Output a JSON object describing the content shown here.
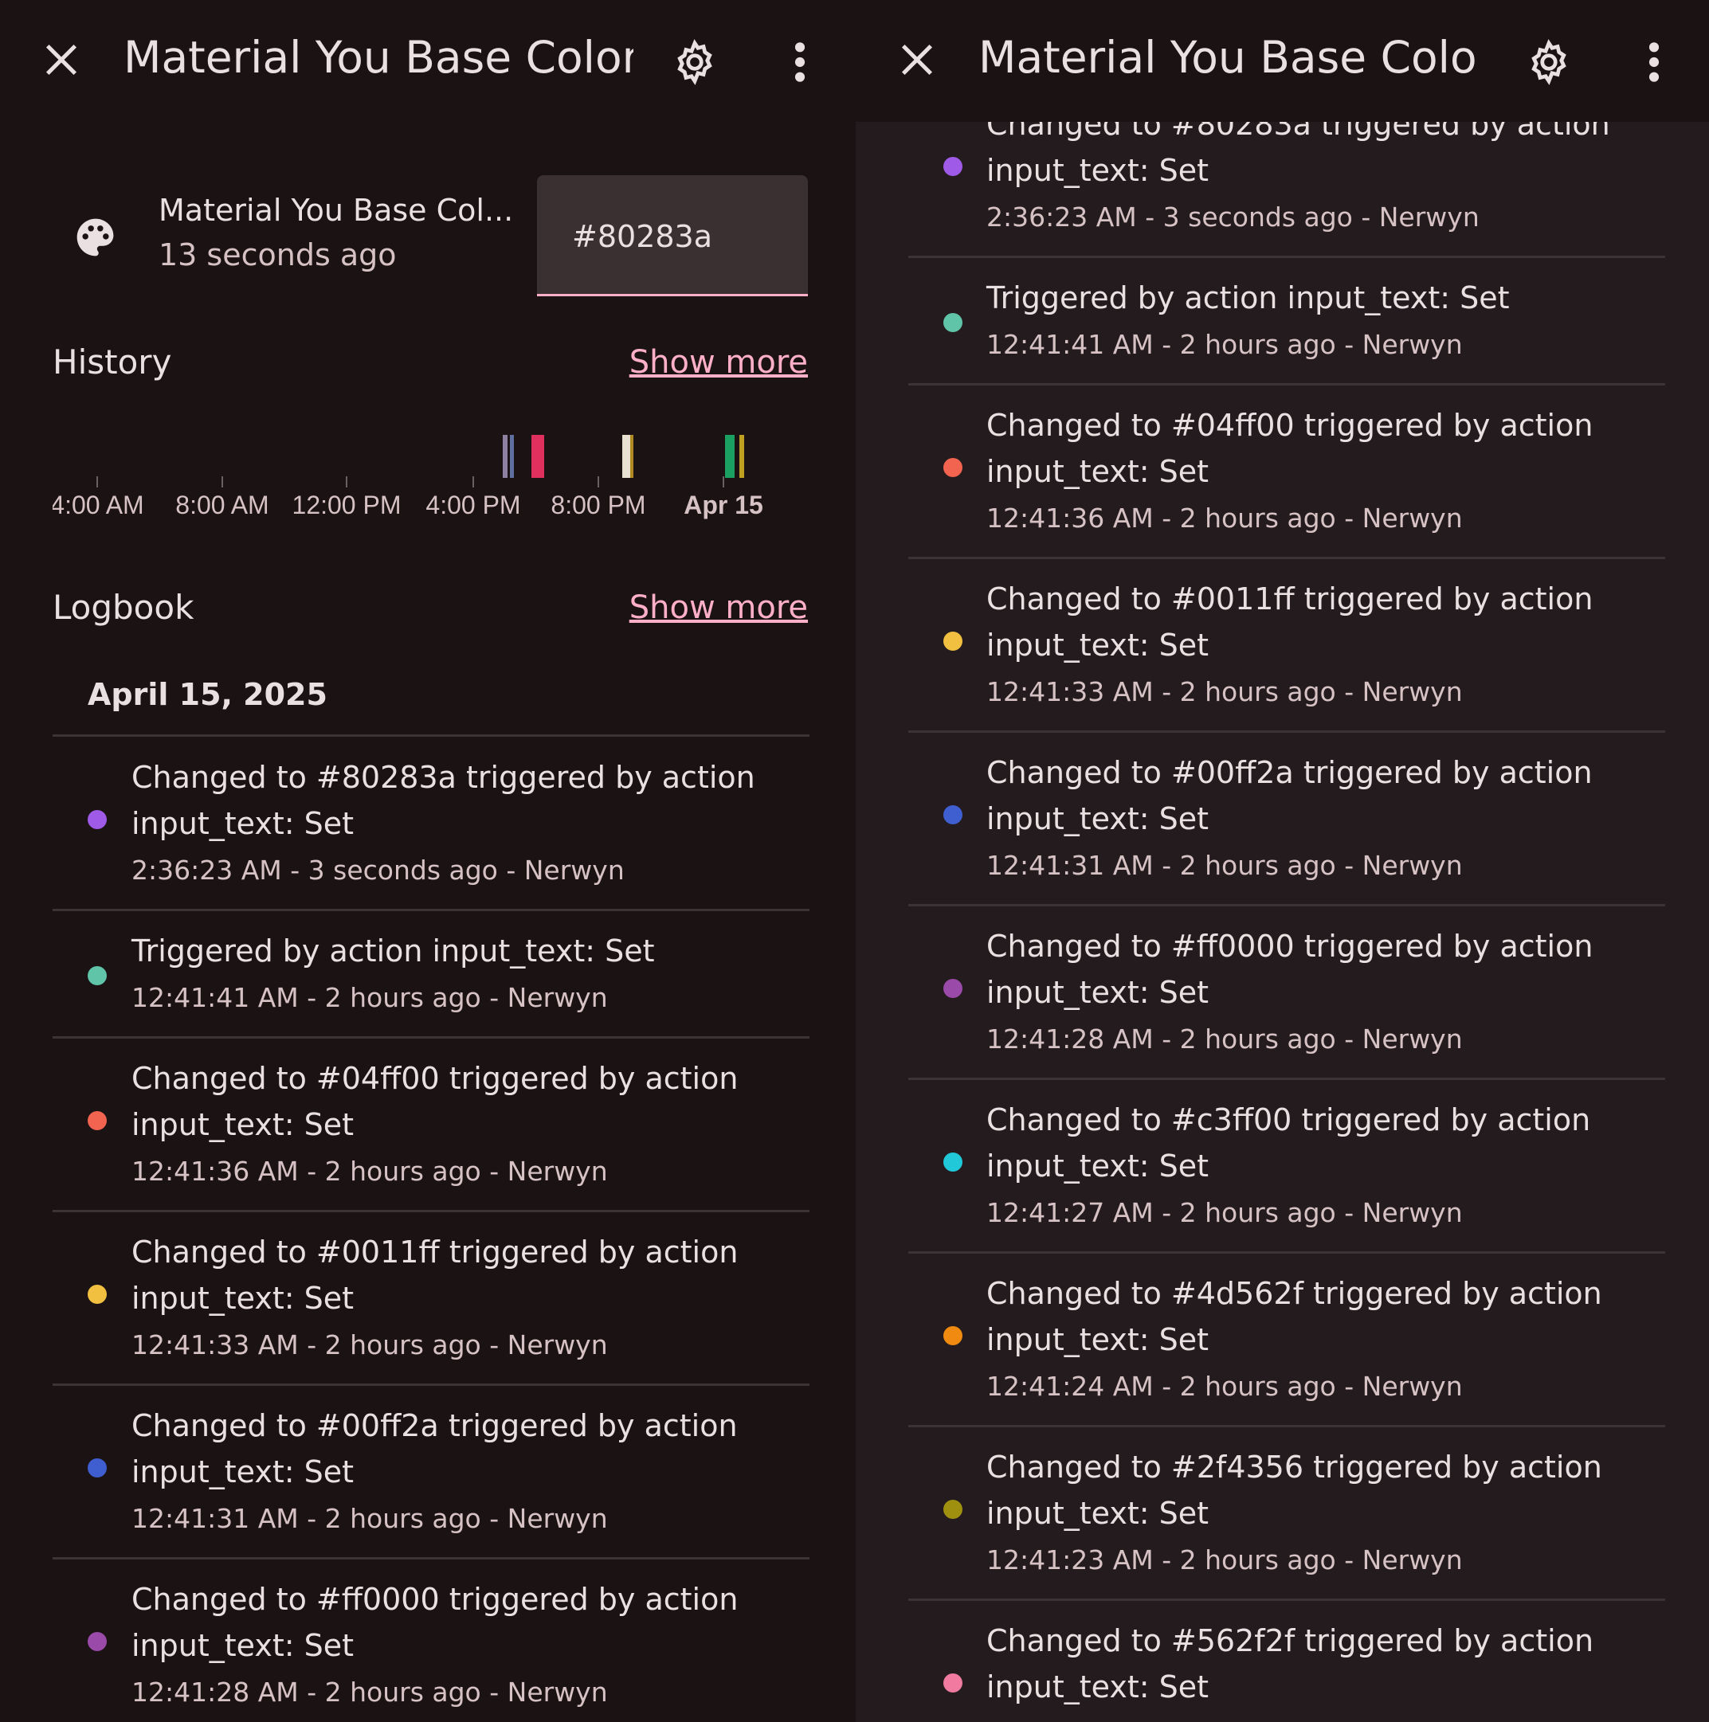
{
  "dialog": {
    "title": "Material You Base Color ...",
    "settings_icon": "gear-icon",
    "close_icon": "close-icon",
    "more_icon": "more-vert-icon"
  },
  "entity": {
    "icon": "palette-icon",
    "name": "Material You Base Col...",
    "last_changed": "13 seconds ago",
    "value": "#80283a"
  },
  "history": {
    "title": "History",
    "show_more": "Show more",
    "chart_data": {
      "type": "timeline",
      "x_ticks": [
        "4:00 AM",
        "8:00 AM",
        "12:00 PM",
        "4:00 PM",
        "8:00 PM",
        "Apr 15"
      ],
      "state_colors": [
        "#8f7fa0",
        "#5f6fa0",
        "#e0305e",
        "#e8e0d0",
        "#b08a20",
        "#1aa060",
        "#c0a020"
      ]
    }
  },
  "logbook": {
    "title": "Logbook",
    "show_more": "Show more",
    "date": "April 15, 2025",
    "entries": [
      {
        "line1": "Changed to #80283a triggered by action",
        "line2": "input_text: Set",
        "meta": "2:36:23 AM - 3 seconds ago - Nerwyn",
        "color": "#a05ae8"
      },
      {
        "line1": "Triggered by action input_text: Set",
        "line2": "",
        "meta": "12:41:41 AM - 2 hours ago - Nerwyn",
        "color": "#5fc4a8"
      },
      {
        "line1": "Changed to #04ff00 triggered by action",
        "line2": "input_text: Set",
        "meta": "12:41:36 AM - 2 hours ago - Nerwyn",
        "color": "#f26450"
      },
      {
        "line1": "Changed to #0011ff triggered by action",
        "line2": "input_text: Set",
        "meta": "12:41:33 AM - 2 hours ago - Nerwyn",
        "color": "#f2c040"
      },
      {
        "line1": "Changed to #00ff2a triggered by action",
        "line2": "input_text: Set",
        "meta": "12:41:31 AM - 2 hours ago - Nerwyn",
        "color": "#3f5fd0"
      },
      {
        "line1": "Changed to #ff0000 triggered by action",
        "line2": "input_text: Set",
        "meta": "12:41:28 AM - 2 hours ago - Nerwyn",
        "color": "#9a4aa8"
      },
      {
        "line1": "Changed to #c3ff00 triggered by action",
        "line2": "input_text: Set",
        "meta": "12:41:27 AM - 2 hours ago - Nerwyn",
        "color": "#20c8d8"
      },
      {
        "line1": "Changed to #4d562f triggered by action",
        "line2": "input_text: Set",
        "meta": "12:41:24 AM - 2 hours ago - Nerwyn",
        "color": "#f08a10"
      },
      {
        "line1": "Changed to #2f4356 triggered by action",
        "line2": "input_text: Set",
        "meta": "12:41:23 AM - 2 hours ago - Nerwyn",
        "color": "#a09010"
      },
      {
        "line1": "Changed to #562f2f triggered by action",
        "line2": "input_text: Set",
        "meta": "",
        "color": "#f07aa0"
      }
    ]
  }
}
